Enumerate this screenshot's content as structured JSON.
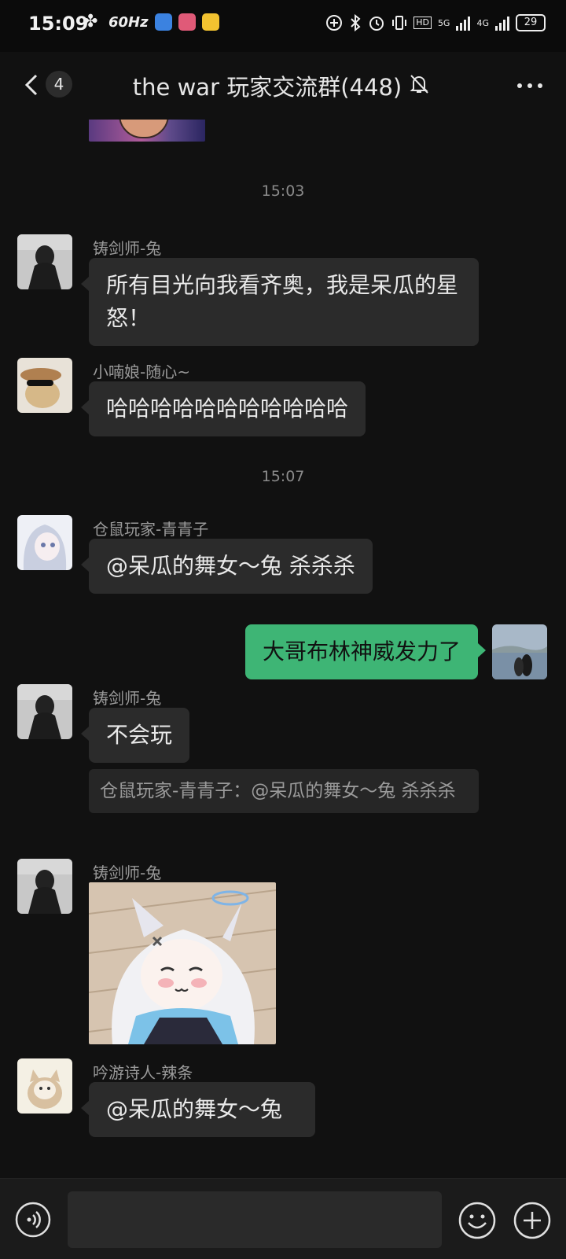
{
  "status_bar": {
    "time": "15:09",
    "refresh_rate": "60Hz",
    "battery": "29",
    "net1": "5G",
    "net2": "4G",
    "hd_label": "HD"
  },
  "nav": {
    "unread_count": "4",
    "title": "the war 玩家交流群(448)"
  },
  "messages": {
    "time1": "15:03",
    "m1": {
      "sender": "铸剑师-兔",
      "text": "所有目光向我看齐奥，我是呆瓜的星怒！"
    },
    "m2": {
      "sender": "小喃娘-随心~",
      "text": "哈哈哈哈哈哈哈哈哈哈哈"
    },
    "time2": "15:07",
    "m3": {
      "sender": "仓鼠玩家-青青子",
      "text": "@呆瓜的舞女～兔  杀杀杀"
    },
    "m4": {
      "text": "大哥布林神威发力了"
    },
    "m5": {
      "sender": "铸剑师-兔",
      "text": "不会玩",
      "quote": "仓鼠玩家-青青子：@呆瓜的舞女～兔 杀杀杀"
    },
    "m6": {
      "sender": "铸剑师-兔"
    },
    "m7": {
      "sender": "吟游诗人-辣条",
      "text": "@呆瓜的舞女～兔"
    }
  },
  "colors": {
    "background": "#111111",
    "bubble_other": "#2b2b2b",
    "bubble_me": "#3eb575"
  }
}
